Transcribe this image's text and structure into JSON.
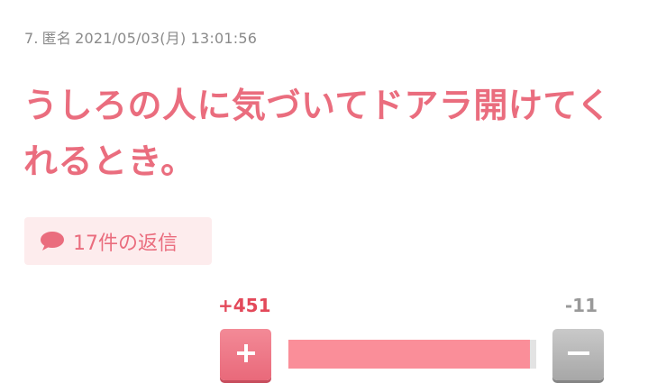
{
  "post": {
    "number": "7.",
    "author": "匿名",
    "datetime": "2021/05/03(月) 13:01:56",
    "text_line1": "うしろの人に気づいてドアラ開けてく",
    "text_line2": "れるとき。"
  },
  "replies": {
    "label": "17件の返信",
    "icon": "speech-bubble-icon"
  },
  "votes": {
    "plus_label": "+451",
    "minus_label": "-11",
    "plus": 451,
    "minus": 11,
    "plus_icon": "plus-icon",
    "minus_icon": "minus-icon"
  },
  "colors": {
    "accent": "#ea6d7e",
    "plus_count": "#e3495a",
    "bar_fill": "#fa8e99",
    "bar_track": "#e3e3e3",
    "minus_button": "#b5b5b5",
    "reply_bg": "#fdeced"
  }
}
